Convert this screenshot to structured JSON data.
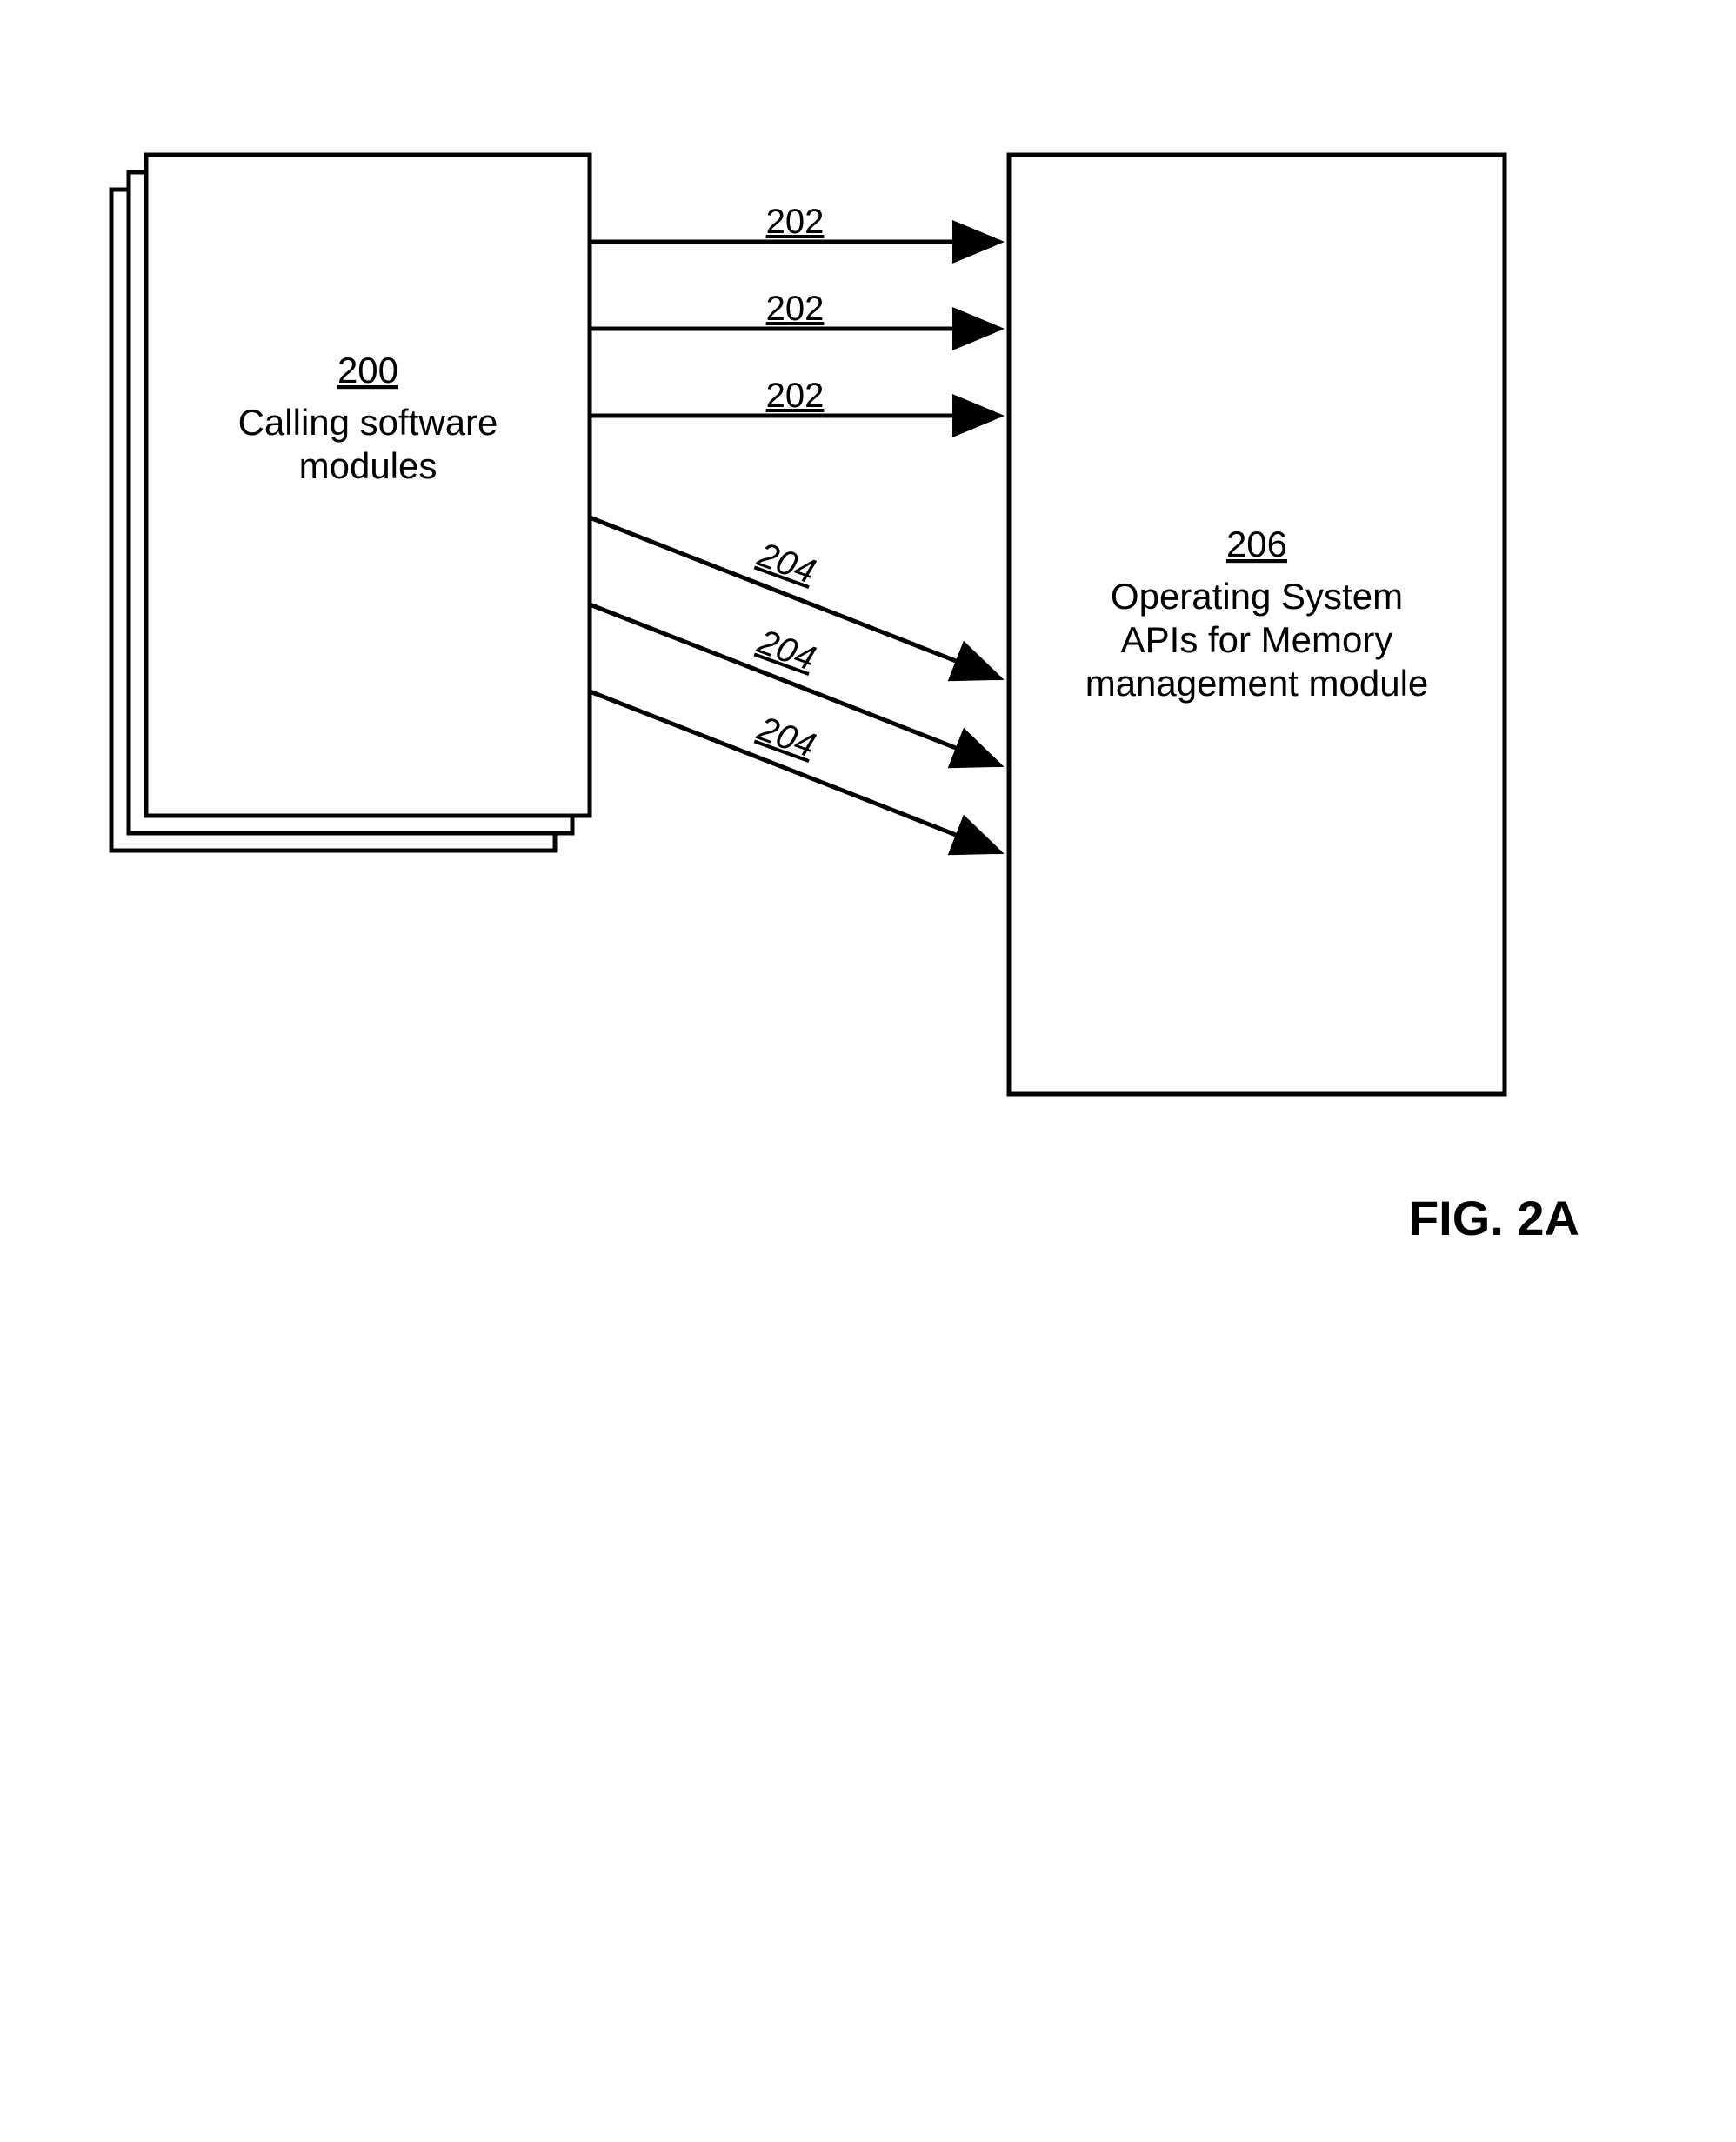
{
  "figure_label": "FIG. 2A",
  "left_box": {
    "ref": "200",
    "line1": "Calling software",
    "line2": "modules"
  },
  "right_box": {
    "ref": "206",
    "line1": "Operating System",
    "line2": "APIs for Memory",
    "line3": "management module"
  },
  "arrows": {
    "top_label": "202",
    "bottom_label": "204"
  }
}
